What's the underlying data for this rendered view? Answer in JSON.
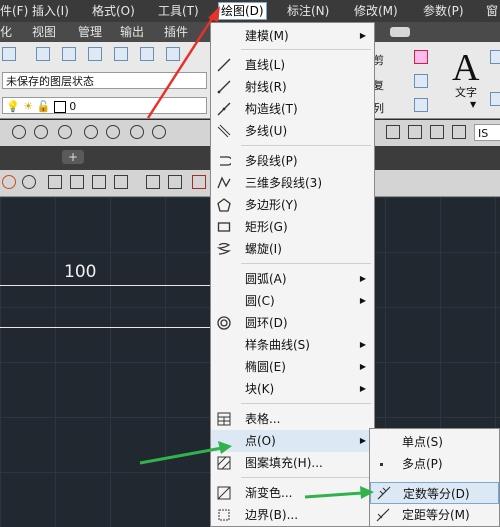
{
  "menubar": {
    "items": [
      {
        "label": "件(F)"
      },
      {
        "label": "插入(I)"
      },
      {
        "label": "格式(O)"
      },
      {
        "label": "工具(T)"
      },
      {
        "label": "绘图(D)"
      },
      {
        "label": "标注(N)"
      },
      {
        "label": "修改(M)"
      },
      {
        "label": "参数(P)"
      },
      {
        "label": "窗"
      }
    ]
  },
  "ribbon_tabs": {
    "items": [
      {
        "label": "化"
      },
      {
        "label": "视图"
      },
      {
        "label": "管理"
      },
      {
        "label": "输出"
      },
      {
        "label": "插件"
      }
    ]
  },
  "ribbon": {
    "layer_state": "未保存的图层状态",
    "layer_value": "0",
    "right_labels": [
      "剪",
      "复",
      "列",
      "文字",
      "剪"
    ],
    "text_big": "A",
    "iso_label": "IS"
  },
  "canvas": {
    "dimension_text": "100"
  },
  "draw_menu": {
    "items": [
      {
        "label": "建模(M)",
        "submenu": true
      },
      {
        "label": "直线(L)"
      },
      {
        "label": "射线(R)"
      },
      {
        "label": "构造线(T)"
      },
      {
        "label": "多线(U)"
      },
      {
        "label": "多段线(P)"
      },
      {
        "label": "三维多段线(3)"
      },
      {
        "label": "多边形(Y)"
      },
      {
        "label": "矩形(G)"
      },
      {
        "label": "螺旋(I)"
      },
      {
        "label": "圆弧(A)",
        "submenu": true
      },
      {
        "label": "圆(C)",
        "submenu": true
      },
      {
        "label": "圆环(D)"
      },
      {
        "label": "样条曲线(S)",
        "submenu": true
      },
      {
        "label": "椭圆(E)",
        "submenu": true
      },
      {
        "label": "块(K)",
        "submenu": true
      },
      {
        "label": "表格..."
      },
      {
        "label": "点(O)",
        "submenu": true
      },
      {
        "label": "图案填充(H)..."
      },
      {
        "label": "渐变色..."
      },
      {
        "label": "边界(B)..."
      }
    ]
  },
  "point_menu": {
    "items": [
      {
        "label": "单点(S)"
      },
      {
        "label": "多点(P)"
      },
      {
        "label": "定数等分(D)"
      },
      {
        "label": "定距等分(M)"
      }
    ]
  },
  "colors": {
    "accent_annotation_red": "#e8312a",
    "accent_annotation_green": "#2fb34a",
    "canvas_bg": "#212830"
  }
}
